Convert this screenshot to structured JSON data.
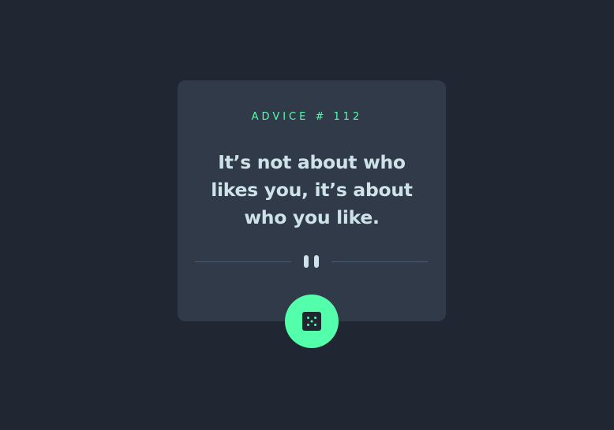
{
  "advice": {
    "label": "ADVICE # 112",
    "quote": "It’s not about who likes you, it’s about who you like."
  },
  "colors": {
    "background": "#202632",
    "card": "#313a48",
    "accent": "#53ffaa",
    "text": "#cee3e9",
    "divider": "#4f5d74"
  },
  "icons": {
    "divider": "pause-divider-icon",
    "button": "dice-icon"
  }
}
